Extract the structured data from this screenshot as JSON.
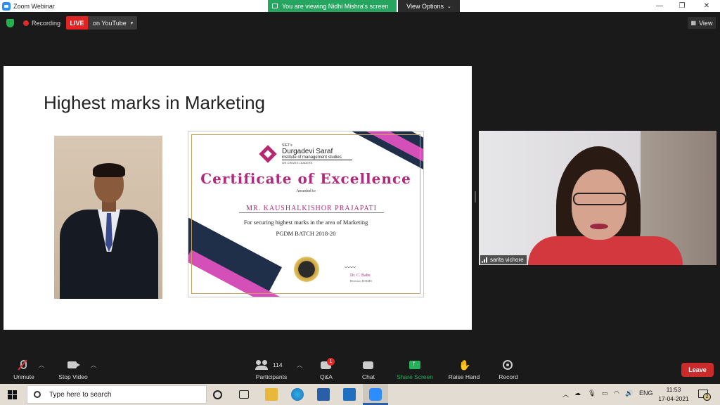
{
  "window": {
    "title": "Zoom Webinar",
    "banner": "You are viewing Nidhi Mishra's screen",
    "view_options": "View Options",
    "min": "—",
    "restore": "❐",
    "close": "✕"
  },
  "status": {
    "recording": "Recording",
    "live": "LIVE",
    "live_target": "on YouTube",
    "view": "View"
  },
  "slide": {
    "title": "Highest marks in Marketing",
    "certificate": {
      "inst_small": "SIET's",
      "inst_name": "Durgadevi Saraf",
      "inst_sub": "institute of management studies",
      "inst_tag": "WE CREATE LEADERS",
      "heading": "Certificate of Excellence",
      "awarded": "Awarded to",
      "recipient": "MR. KAUSHALKISHOR PRAJAPATI",
      "reason": "For securing highest marks in the area of Marketing",
      "batch": "PGDM BATCH 2018-20",
      "signatory": "Dr. C. Babu",
      "signatory_title": "Director, DSIMS"
    }
  },
  "participant_video": {
    "name": "sarita vichore"
  },
  "toolbar": {
    "unmute": "Unmute",
    "stop_video": "Stop Video",
    "participants": "Participants",
    "participants_count": "114",
    "qa": "Q&A",
    "qa_badge": "1",
    "chat": "Chat",
    "share_screen": "Share Screen",
    "raise_hand": "Raise Hand",
    "record": "Record",
    "leave": "Leave",
    "colors": {
      "share": "#25b15a",
      "leave": "#cc2b2b",
      "live": "#e02424"
    }
  },
  "taskbar": {
    "search_placeholder": "Type here to search",
    "language": "ENG",
    "time": "11:53",
    "date": "17-04-2021",
    "notification_count": "2"
  }
}
